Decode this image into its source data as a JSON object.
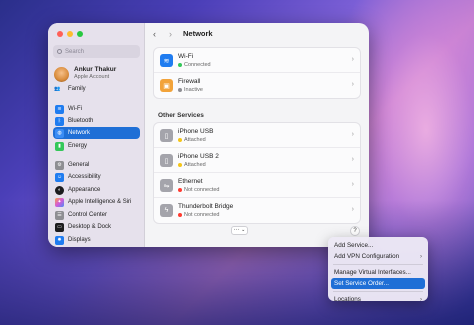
{
  "sidebar": {
    "search_placeholder": "Search",
    "account": {
      "name": "Ankur Thakur",
      "subtitle": "Apple Account"
    },
    "family": "Family",
    "items": [
      {
        "label": "Wi-Fi",
        "icon": "wifi-icon",
        "color": "#1f7cf0"
      },
      {
        "label": "Bluetooth",
        "icon": "bluetooth-icon",
        "color": "#1f7cf0"
      },
      {
        "label": "Network",
        "icon": "globe-icon",
        "color": "#1f7cf0"
      },
      {
        "label": "Energy",
        "icon": "battery-icon",
        "color": "#34c759"
      },
      {
        "label": "General",
        "icon": "gear-icon",
        "color": "#8e8e93"
      },
      {
        "label": "Accessibility",
        "icon": "accessibility-icon",
        "color": "#1f7cf0"
      },
      {
        "label": "Appearance",
        "icon": "appearance-icon",
        "color": "#1c1c1e"
      },
      {
        "label": "Apple Intelligence & Siri",
        "icon": "siri-icon",
        "color": "#c46bd9"
      },
      {
        "label": "Control Center",
        "icon": "control-center-icon",
        "color": "#8e8e93"
      },
      {
        "label": "Desktop & Dock",
        "icon": "dock-icon",
        "color": "#1c1c1e"
      },
      {
        "label": "Displays",
        "icon": "display-icon",
        "color": "#1f7cf0"
      }
    ]
  },
  "content": {
    "title": "Network",
    "services": [
      {
        "title": "Wi-Fi",
        "status": "Connected",
        "dot": "#34c759",
        "icon": "wifi-icon",
        "color": "#1f7cf0"
      },
      {
        "title": "Firewall",
        "status": "Inactive",
        "dot": "#8e8e93",
        "icon": "firewall-icon",
        "color": "#f2a33a"
      }
    ],
    "other_label": "Other Services",
    "other_services": [
      {
        "title": "iPhone USB",
        "status": "Attached",
        "dot": "#f5c518",
        "icon": "phone-icon",
        "color": "#a4a4ab"
      },
      {
        "title": "iPhone USB 2",
        "status": "Attached",
        "dot": "#f5c518",
        "icon": "phone-icon",
        "color": "#a4a4ab"
      },
      {
        "title": "Ethernet",
        "status": "Not connected",
        "dot": "#ff3b30",
        "icon": "ethernet-icon",
        "color": "#a4a4ab"
      },
      {
        "title": "Thunderbolt Bridge",
        "status": "Not connected",
        "dot": "#ff3b30",
        "icon": "thunderbolt-icon",
        "color": "#a4a4ab"
      }
    ],
    "more_button": "···",
    "help_button": "?"
  },
  "menu": {
    "items": [
      "Add Service...",
      "Add VPN Configuration",
      "Manage Virtual Interfaces...",
      "Set Service Order...",
      "Locations"
    ]
  }
}
